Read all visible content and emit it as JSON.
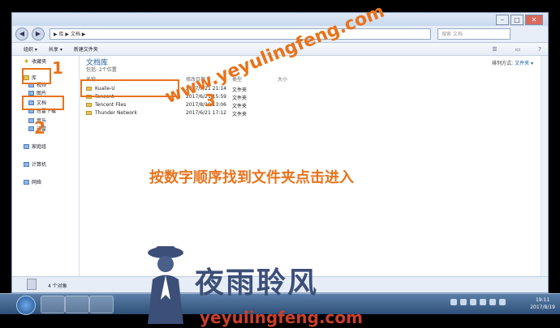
{
  "window": {
    "address_path": "▶ 库 ▶ 文档 ▶",
    "search_placeholder": "搜索 文档",
    "toolbar": {
      "organize": "组织 ▾",
      "share": "共享 ▾",
      "new_folder": "新建文件夹"
    }
  },
  "sidebar": {
    "favorites": "收藏夹",
    "library": "库",
    "videos": "视频",
    "pictures": "图片",
    "documents": "文档",
    "thunder": "迅雷下载",
    "music": "音乐",
    "xunlei": "迅雷",
    "homegroup": "家庭组",
    "computer": "计算机",
    "network": "网络"
  },
  "content": {
    "title": "文档库",
    "subtitle": "包括: 2个位置",
    "arrange_label": "排列方式:",
    "arrange_value": "文件夹 ▾",
    "columns": {
      "name": "名称",
      "modified": "修改日期",
      "type": "类型",
      "size": "大小"
    },
    "rows": [
      {
        "name": "Kuaile-U",
        "date": "2017/7/21 21:14",
        "type": "文件夹"
      },
      {
        "name": "Tencent",
        "date": "2017/6/21 15:59",
        "type": "文件夹"
      },
      {
        "name": "Tencent Files",
        "date": "2017/8/19 13:06",
        "type": "文件夹"
      },
      {
        "name": "Thunder Network",
        "date": "2017/6/21 17:12",
        "type": "文件夹"
      }
    ]
  },
  "status": {
    "count": "4 个对象"
  },
  "clock": {
    "time": "19:11",
    "date": "2017/8/19"
  },
  "annotations": {
    "step1": "1",
    "step2": "2",
    "step3": "3",
    "instruction": "按数字顺序找到文件夹点击进入",
    "watermark": "www.yeyulingfeng.com",
    "brand": "夜雨聆风",
    "brand_url": "yeyulingfeng.com"
  },
  "colors": {
    "accent_orange": "#e8731c",
    "brand_navy": "#3c4f78",
    "brand_red": "#c93f2b"
  }
}
